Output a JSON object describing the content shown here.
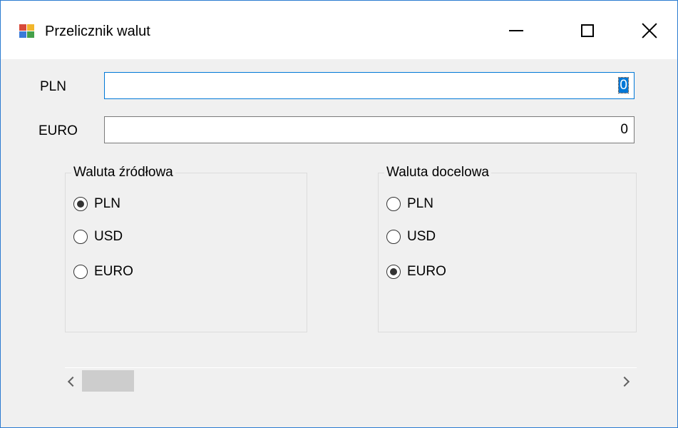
{
  "window": {
    "title": "Przelicznik walut",
    "icon": "app-form-icon"
  },
  "fields": {
    "pln": {
      "label": "PLN",
      "value": "0"
    },
    "euro": {
      "label": "EURO",
      "value": "0"
    }
  },
  "source_group": {
    "title": "Waluta źródłowa",
    "options": [
      {
        "label": "PLN",
        "checked": true
      },
      {
        "label": "USD",
        "checked": false
      },
      {
        "label": "EURO",
        "checked": false
      }
    ]
  },
  "target_group": {
    "title": "Waluta docelowa",
    "options": [
      {
        "label": "PLN",
        "checked": false
      },
      {
        "label": "USD",
        "checked": false
      },
      {
        "label": "EURO",
        "checked": true
      }
    ]
  },
  "scrollbar": {
    "position": 0
  },
  "colors": {
    "accent": "#0078d7",
    "window_bg": "#f0f0f0",
    "border": "#2b7bd1"
  }
}
